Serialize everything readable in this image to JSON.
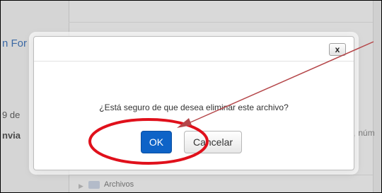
{
  "background": {
    "title_fragment": "n For",
    "date_fragment": "9 de",
    "env_fragment": "nvia",
    "num_fragment": "8, núm",
    "files_label": "Archivos"
  },
  "dialog": {
    "close_label": "x",
    "message": "¿Está seguro de que desea eliminar este archivo?",
    "ok_label": "OK",
    "cancel_label": "Cancelar"
  },
  "annotation_color": "#e0101b",
  "arrow_color": "#b5474a"
}
